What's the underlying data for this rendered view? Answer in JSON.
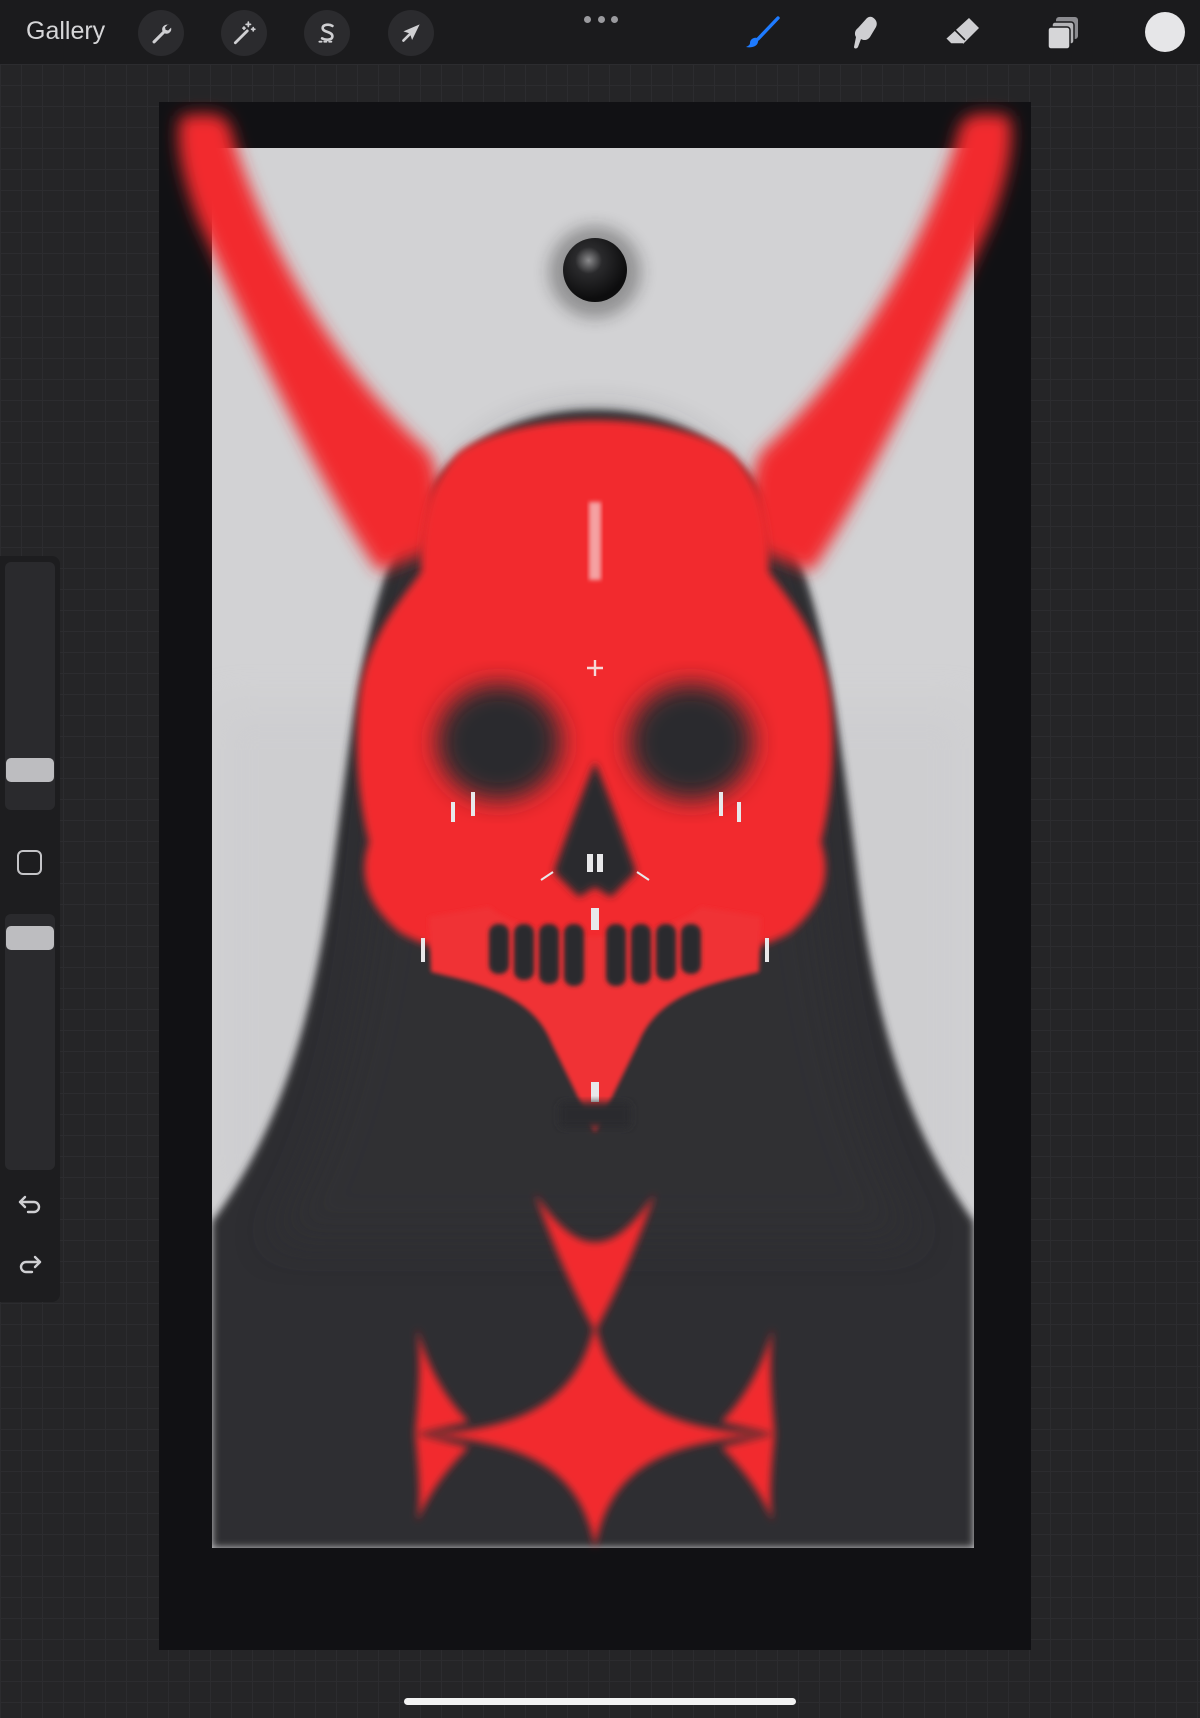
{
  "toolbar": {
    "gallery_label": "Gallery",
    "left_tools": [
      {
        "name": "actions",
        "icon": "wrench-icon"
      },
      {
        "name": "adjustments",
        "icon": "magic-wand-icon"
      },
      {
        "name": "selection",
        "icon": "selection-s-icon"
      },
      {
        "name": "transform",
        "icon": "arrow-cursor-icon"
      }
    ],
    "right_tools": [
      {
        "name": "brush",
        "icon": "brush-icon",
        "active": true
      },
      {
        "name": "smudge",
        "icon": "smudge-finger-icon"
      },
      {
        "name": "eraser",
        "icon": "eraser-icon"
      },
      {
        "name": "layers",
        "icon": "layers-icon"
      }
    ],
    "active_color": "#e6e6e8",
    "accent_color": "#1e7bff"
  },
  "sidebar": {
    "brush_size_level": 0.16,
    "opacity_level": 0.94
  },
  "artwork": {
    "background": "#cfcfd1",
    "figure_color": "#2d2d30",
    "accent_red": "#f22a2e"
  }
}
